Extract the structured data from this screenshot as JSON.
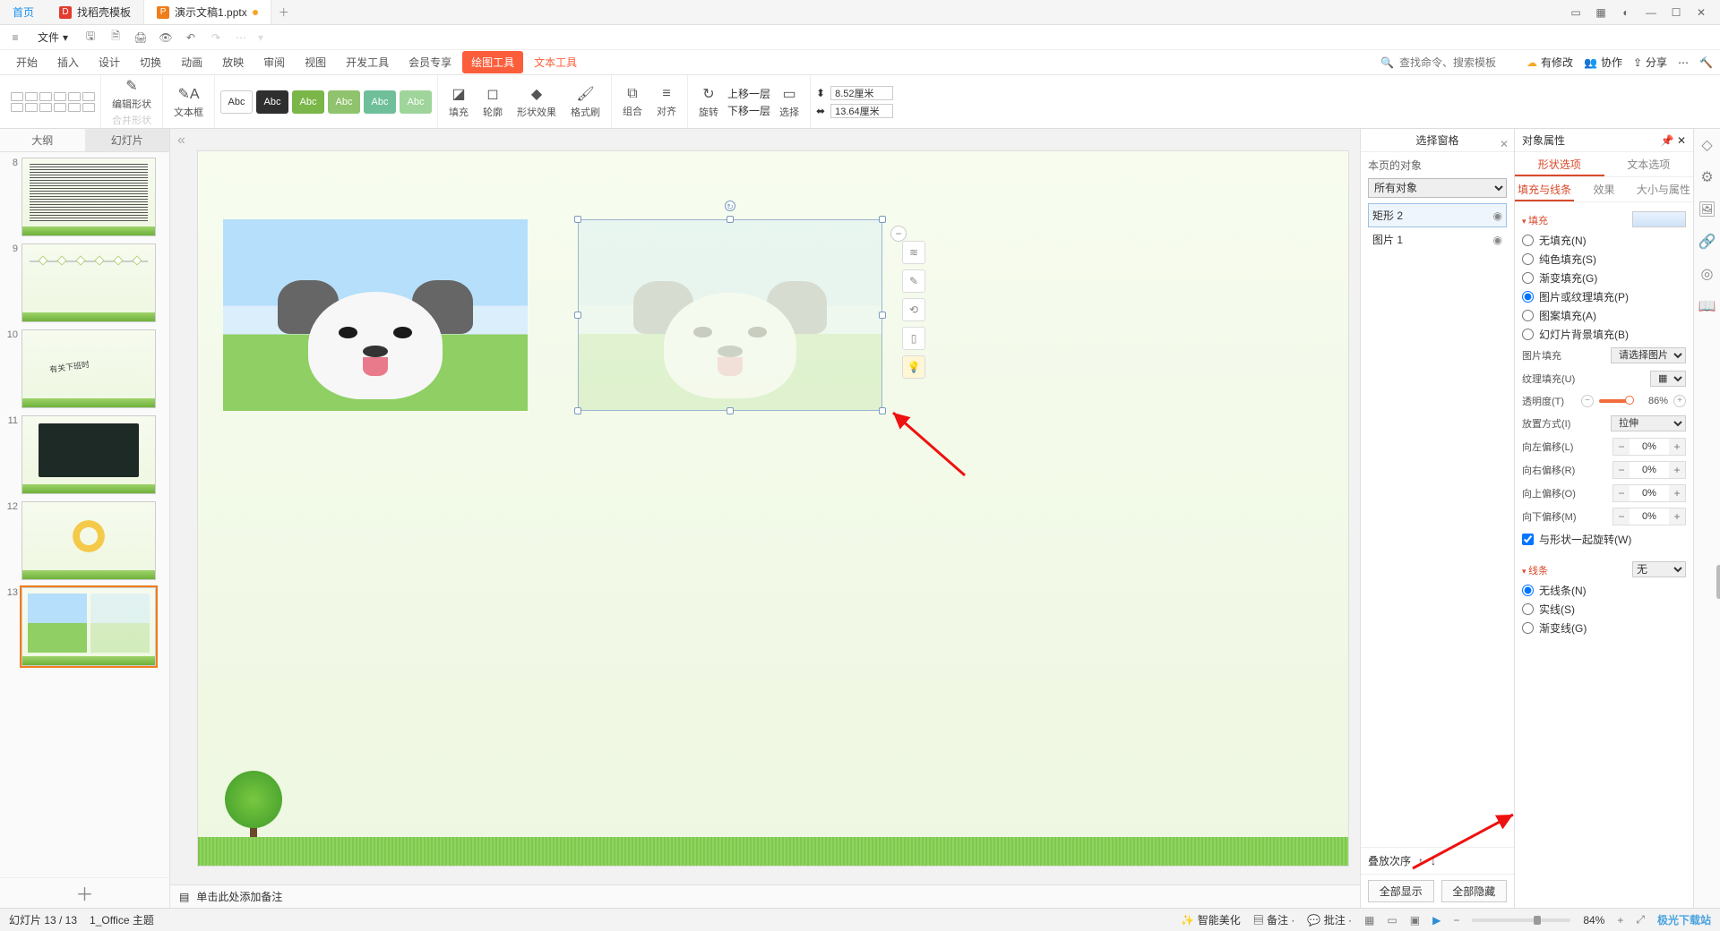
{
  "tabs": {
    "home": "首页",
    "template": "找稻壳模板",
    "doc": "演示文稿1.pptx"
  },
  "file_label": "文件",
  "menu": {
    "start": "开始",
    "insert": "插入",
    "design": "设计",
    "transition": "切换",
    "animation": "动画",
    "slideshow": "放映",
    "review": "审阅",
    "view": "视图",
    "dev": "开发工具",
    "member": "会员专享",
    "draw": "绘图工具",
    "text": "文本工具"
  },
  "search_placeholder": "查找命令、搜索模板",
  "top_right": {
    "pending": "有修改",
    "collab": "协作",
    "share": "分享"
  },
  "ribbon": {
    "edit_shape": "编辑形状",
    "merge_shape": "合并形状",
    "textbox": "文本框",
    "abc": "Abc",
    "fill": "填充",
    "outline": "轮廓",
    "effect": "形状效果",
    "fmt_painter": "格式刷",
    "group": "组合",
    "align": "对齐",
    "rotate": "旋转",
    "bring_fwd": "上移一层",
    "send_back": "下移一层",
    "select": "选择",
    "width": "8.52厘米",
    "height": "13.64厘米"
  },
  "thumb_tabs": {
    "outline": "大纲",
    "slides": "幻灯片"
  },
  "thumb_nums": [
    "8",
    "9",
    "10",
    "11",
    "12",
    "13"
  ],
  "notes_hint": "单击此处添加备注",
  "sel_pane": {
    "title": "选择窗格",
    "objs_label": "本页的对象",
    "filter": "所有对象",
    "obj1": "矩形 2",
    "obj2": "图片 1",
    "stack": "叠放次序",
    "show_all": "全部显示",
    "hide_all": "全部隐藏"
  },
  "props": {
    "title": "对象属性",
    "shape_opts": "形状选项",
    "text_opts": "文本选项",
    "fill_line": "填充与线条",
    "effects": "效果",
    "size_prop": "大小与属性",
    "fill_sect": "填充",
    "nofill": "无填充(N)",
    "solid": "纯色填充(S)",
    "grad": "渐变填充(G)",
    "pic": "图片或纹理填充(P)",
    "pattern": "图案填充(A)",
    "slidebg": "幻灯片背景填充(B)",
    "pic_fill": "图片填充",
    "pic_fill_val": "请选择图片",
    "tex_fill": "纹理填充(U)",
    "transparency": "透明度(T)",
    "transparency_val": "86%",
    "placement": "放置方式(I)",
    "placement_val": "拉伸",
    "off_l": "向左偏移(L)",
    "off_r": "向右偏移(R)",
    "off_t": "向上偏移(O)",
    "off_b": "向下偏移(M)",
    "offset_val": "0%",
    "rotate_with": "与形状一起旋转(W)",
    "line_sect": "线条",
    "line_val": "无",
    "noline": "无线条(N)",
    "solidline": "实线(S)",
    "gradline": "渐变线(G)"
  },
  "status": {
    "slide_counter": "幻灯片 13 / 13",
    "theme": "1_Office 主题",
    "smart": "智能美化",
    "notes": "备注",
    "comments": "批注",
    "zoom": "84%",
    "brand": "极光下载站"
  }
}
